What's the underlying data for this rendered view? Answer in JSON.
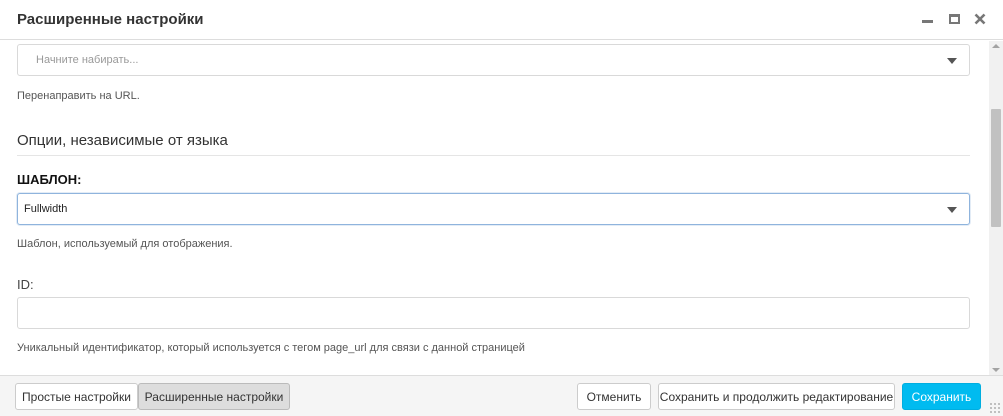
{
  "window": {
    "title": "Расширенные настройки"
  },
  "redirect": {
    "placeholder": "Начните набирать...",
    "help": "Перенаправить на URL."
  },
  "section": {
    "heading": "Опции, независимые от языка"
  },
  "template": {
    "label": "ШАБЛОН:",
    "value": "Fullwidth",
    "help": "Шаблон, используемый для отображения."
  },
  "id_field": {
    "label": "ID:",
    "value": "",
    "help": "Уникальный идентификатор, который используется с тегом page_url для связи с данной страницей"
  },
  "footer": {
    "simple_label": "Простые настройки",
    "advanced_label": "Расширенные настройки",
    "cancel_label": "Отменить",
    "save_continue_label": "Сохранить и продолжить редактирование",
    "save_label": "Сохранить"
  },
  "colors": {
    "primary": "#00bbf0",
    "focus_border": "#8fb4dd"
  },
  "icons": {
    "minimize": "minimize-icon",
    "maximize": "maximize-icon",
    "close": "close-icon",
    "dropdown": "chevron-down-icon"
  }
}
